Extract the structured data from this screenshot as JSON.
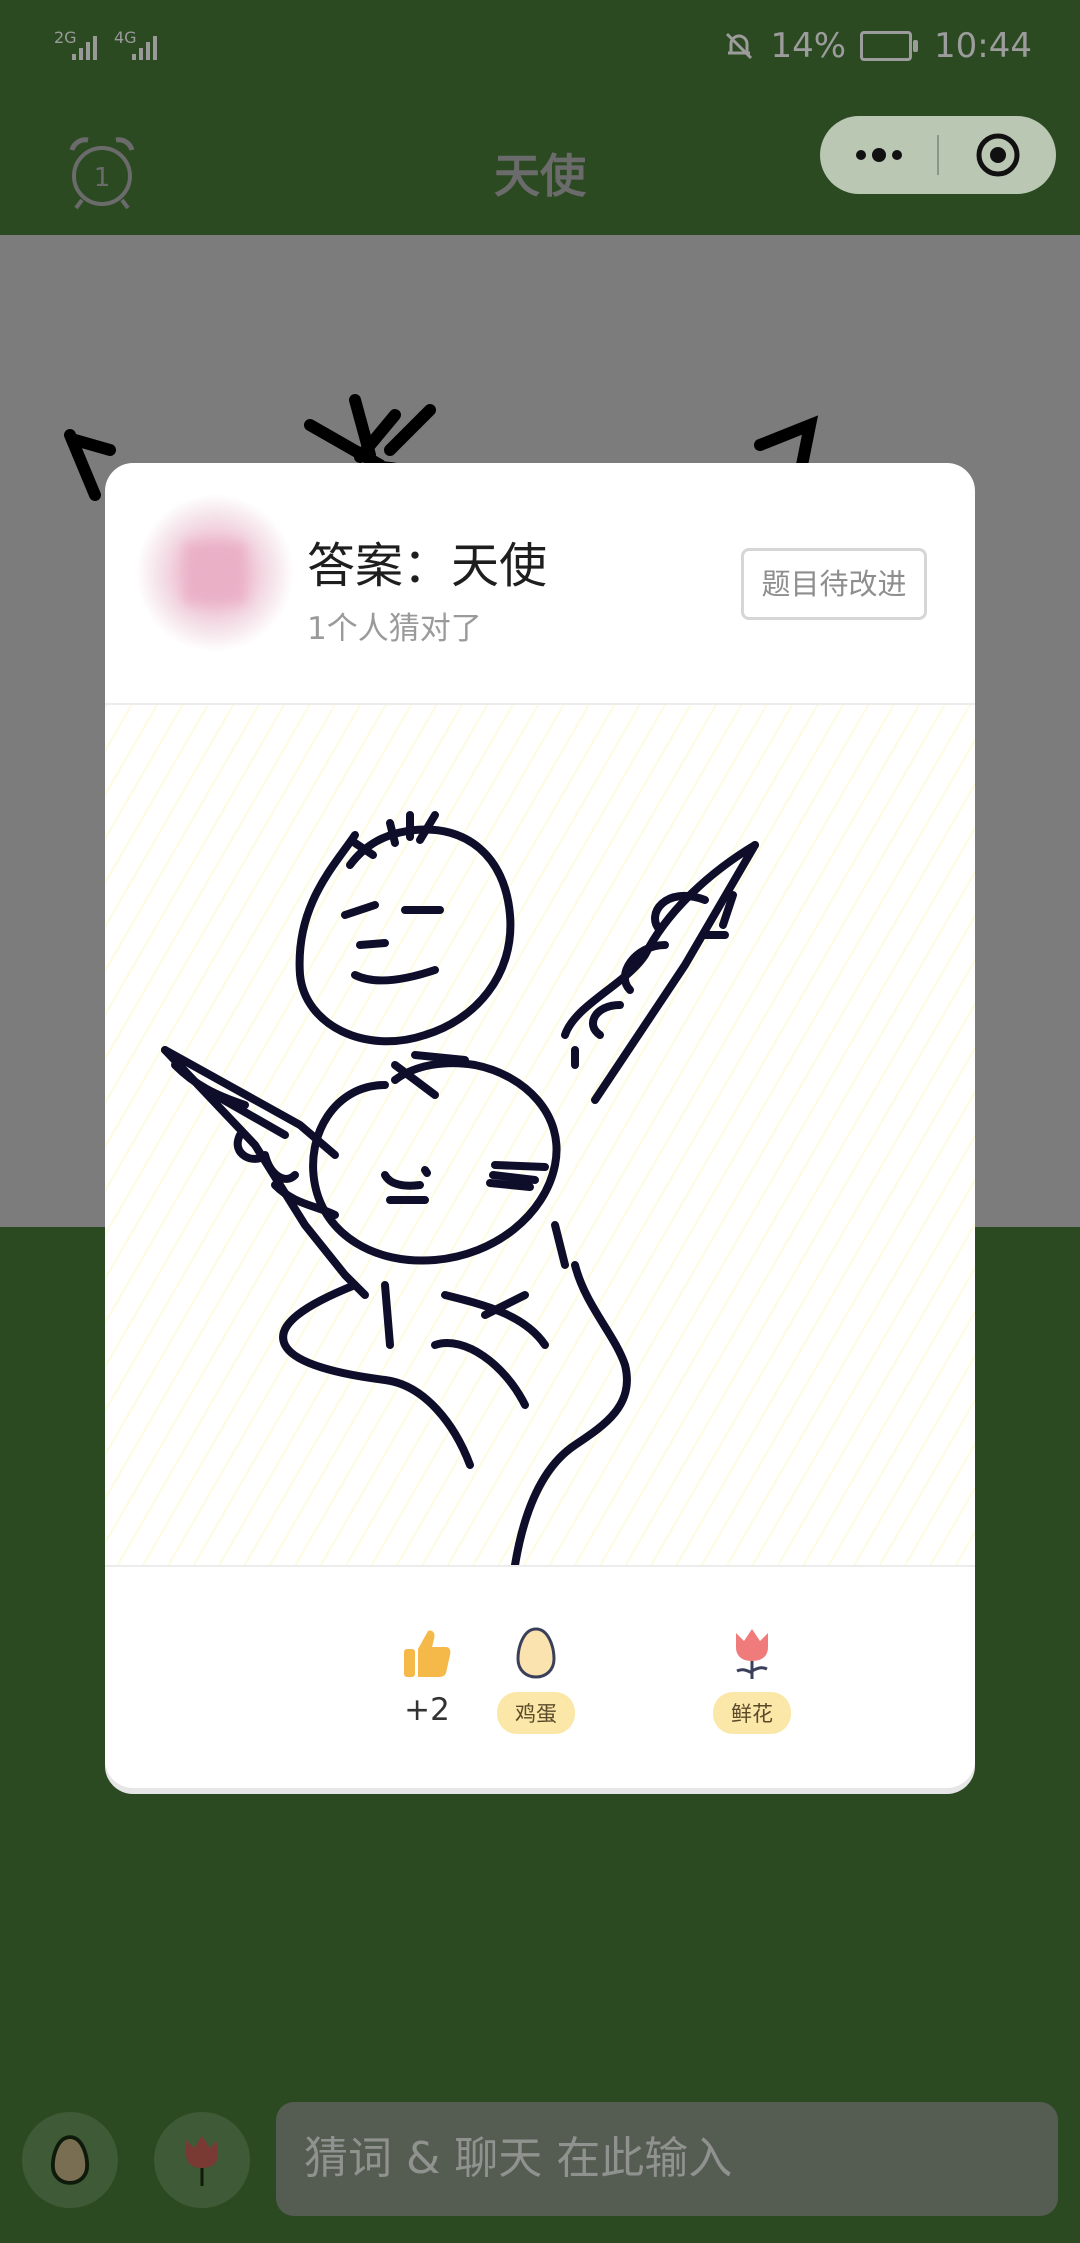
{
  "status_bar": {
    "network_1": "2G",
    "network_2": "4G",
    "battery": "14%",
    "time": "10:44"
  },
  "title_bar": {
    "title": "天使",
    "alarm_count": "1"
  },
  "modal": {
    "answer_text": "答案：天使",
    "correct_count": "1个人猜对了",
    "improve_button": "题目待改进",
    "reactions": {
      "like_count": "+2",
      "egg_label": "鸡蛋",
      "flower_label": "鲜花"
    }
  },
  "bottom_bar": {
    "input_placeholder": "猜词 & 聊天 在此输入"
  },
  "colors": {
    "primary_green": "#2b4a22",
    "capsule": "#b9c7b3",
    "pill": "#fbe7a8",
    "like": "#f5b94a",
    "flower": "#ef7b7b"
  }
}
